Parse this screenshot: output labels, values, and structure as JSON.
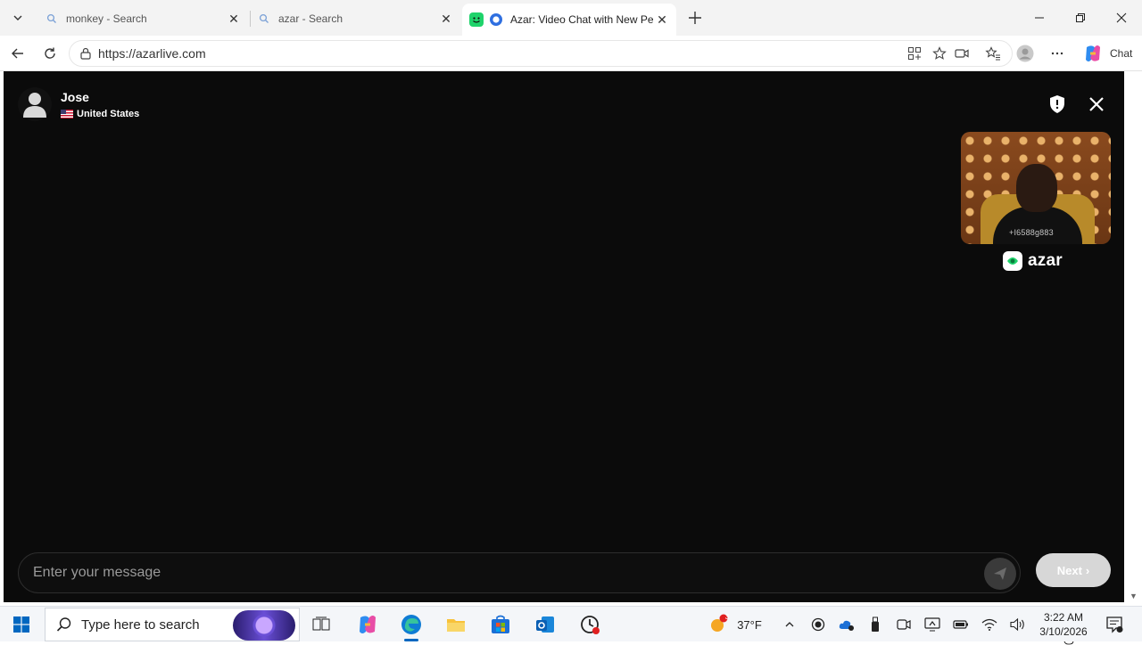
{
  "browser": {
    "tabs": [
      {
        "title": "monkey - Search",
        "active": false
      },
      {
        "title": "azar - Search",
        "active": false
      },
      {
        "title": "Azar: Video Chat with New Pe",
        "active": true
      }
    ],
    "url": "https://azarlive.com",
    "copilot_label": "Chat"
  },
  "page": {
    "peer": {
      "name": "Jose",
      "country": "United States"
    },
    "selfview_watermark": "+I6588g883",
    "brand": "azar",
    "message_placeholder": "Enter your message",
    "next_label": "Next"
  },
  "taskbar": {
    "search_placeholder": "Type here to search",
    "weather_badge": "3",
    "temperature": "37°F",
    "time": "3:22 AM",
    "date": "3/10/2026"
  },
  "colors": {
    "page_bg": "#0b0b0b",
    "brand_green": "#1fd36b",
    "edge_blue": "#0067c0"
  }
}
